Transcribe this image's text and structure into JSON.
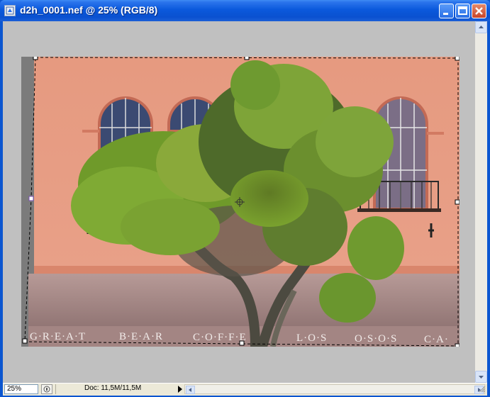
{
  "window": {
    "title": "d2h_0001.nef @ 25% (RGB/8)"
  },
  "icons": {
    "app": "document-icon",
    "minimize": "minimize-icon",
    "maximize": "maximize-icon",
    "close": "close-icon"
  },
  "photo": {
    "awning_lettering": [
      "G·R·E·A·T",
      "B·E·A·R",
      "C·O·F·F·E",
      "L·O·S",
      "O·S·O·S",
      "C·A·"
    ]
  },
  "statusbar": {
    "zoom": "25%",
    "doc_info": "Doc: 11,5M/11,5M"
  },
  "colors": {
    "canvas_bg": "#c0c0c0",
    "wall": "#e39a82",
    "awning": "#a98b88"
  }
}
